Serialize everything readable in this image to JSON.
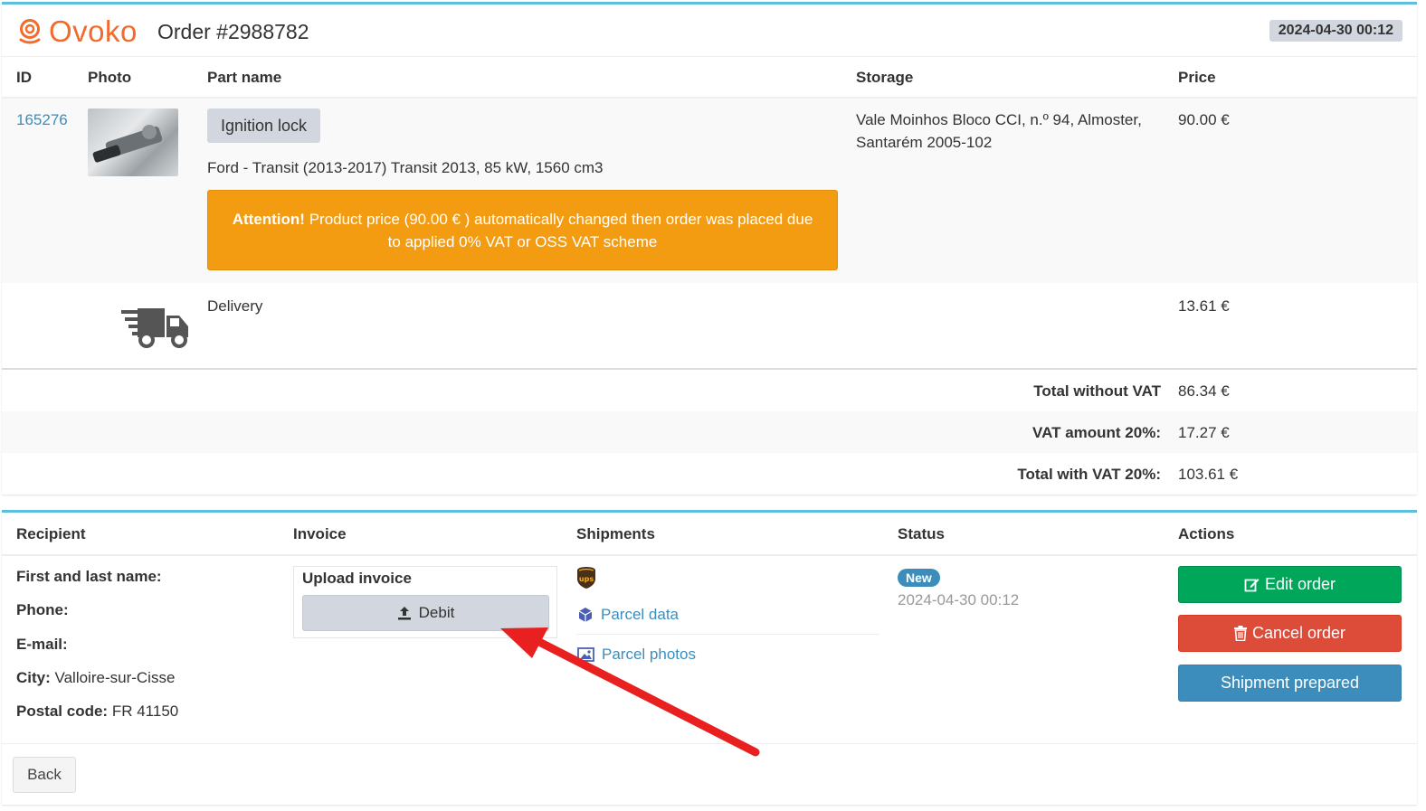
{
  "header": {
    "brand": "Ovoko",
    "order_title": "Order #2988782",
    "date": "2024-04-30 00:12"
  },
  "table": {
    "columns": [
      "ID",
      "Photo",
      "Part name",
      "Storage",
      "Price"
    ],
    "item": {
      "id": "165276",
      "part_name": "Ignition lock",
      "vehicle": "Ford - Transit (2013-2017) Transit 2013, 85 kW, 1560 cm3",
      "storage_line1": "Vale Moinhos Bloco CCI, n.º 94, Almoster,",
      "storage_line2": "Santarém 2005-102",
      "price": "90.00 €",
      "alert_strong": "Attention!",
      "alert_line1": "Product price (90.00 € ) automatically changed then order was placed due",
      "alert_line2": "to applied 0% VAT or OSS VAT scheme"
    },
    "delivery": {
      "label": "Delivery",
      "price": "13.61 €"
    }
  },
  "totals": [
    {
      "label": "Total without VAT",
      "value": "86.34 €"
    },
    {
      "label": "VAT amount 20%:",
      "value": "17.27 €"
    },
    {
      "label": "Total with VAT 20%:",
      "value": "103.61 €"
    }
  ],
  "details": {
    "columns": [
      "Recipient",
      "Invoice",
      "Shipments",
      "Status",
      "Actions"
    ],
    "recipient": {
      "name_label": "First and last name:",
      "phone_label": "Phone:",
      "email_label": "E-mail:",
      "city_label": "City:",
      "city_value": "Valloire-sur-Cisse",
      "postal_label": "Postal code:",
      "postal_value": "FR 41150"
    },
    "invoice": {
      "upload_title": "Upload invoice",
      "debit_label": "Debit"
    },
    "shipments": {
      "carrier_badge": "ups",
      "parcel_data": "Parcel data",
      "parcel_photos": "Parcel photos"
    },
    "status": {
      "badge": "New",
      "date": "2024-04-30 00:12"
    },
    "actions": {
      "edit": "Edit order",
      "cancel": "Cancel order",
      "prepared": "Shipment prepared"
    }
  },
  "footer": {
    "back": "Back"
  },
  "colors": {
    "brand": "#f26b2b",
    "accent_border": "#5bc0de",
    "alert": "#f39c12",
    "success": "#00a65a",
    "danger": "#dd4b39",
    "primary": "#3c8dbc",
    "annotation_arrow": "#e8201f"
  }
}
